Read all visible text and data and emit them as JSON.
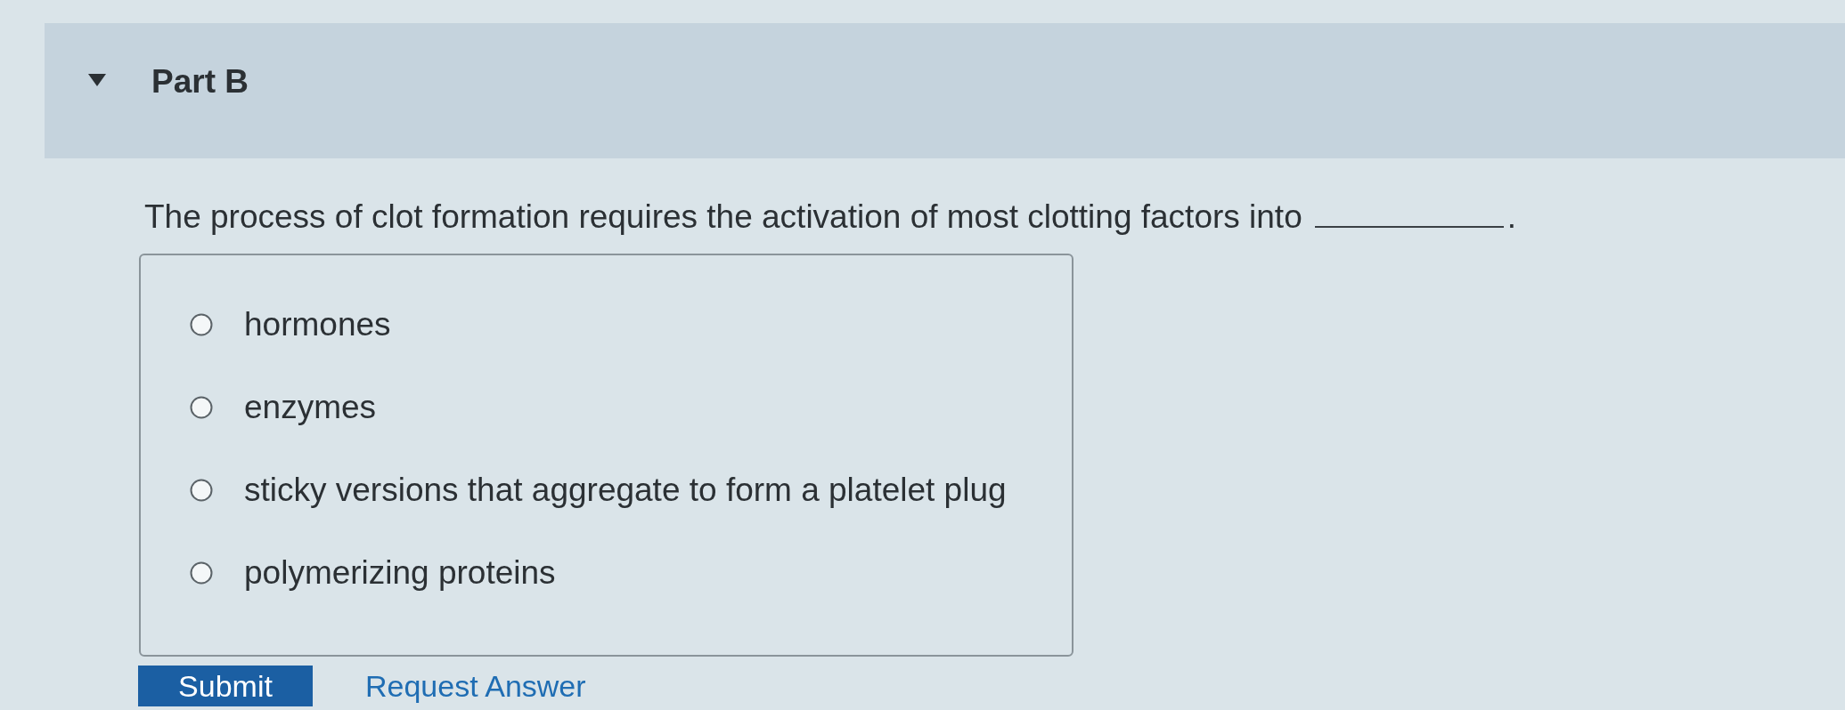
{
  "part": {
    "title": "Part B",
    "expanded": true
  },
  "question": {
    "text": "The process of clot formation requires the activation of most clotting factors into",
    "suffix": "."
  },
  "options": [
    {
      "label": "hormones",
      "selected": false
    },
    {
      "label": "enzymes",
      "selected": false
    },
    {
      "label": "sticky versions that aggregate to form a platelet plug",
      "selected": false
    },
    {
      "label": "polymerizing proteins",
      "selected": false
    }
  ],
  "buttons": [
    {
      "label": "Submit",
      "kind": "primary"
    },
    {
      "label": "Request Answer",
      "kind": "link"
    }
  ]
}
